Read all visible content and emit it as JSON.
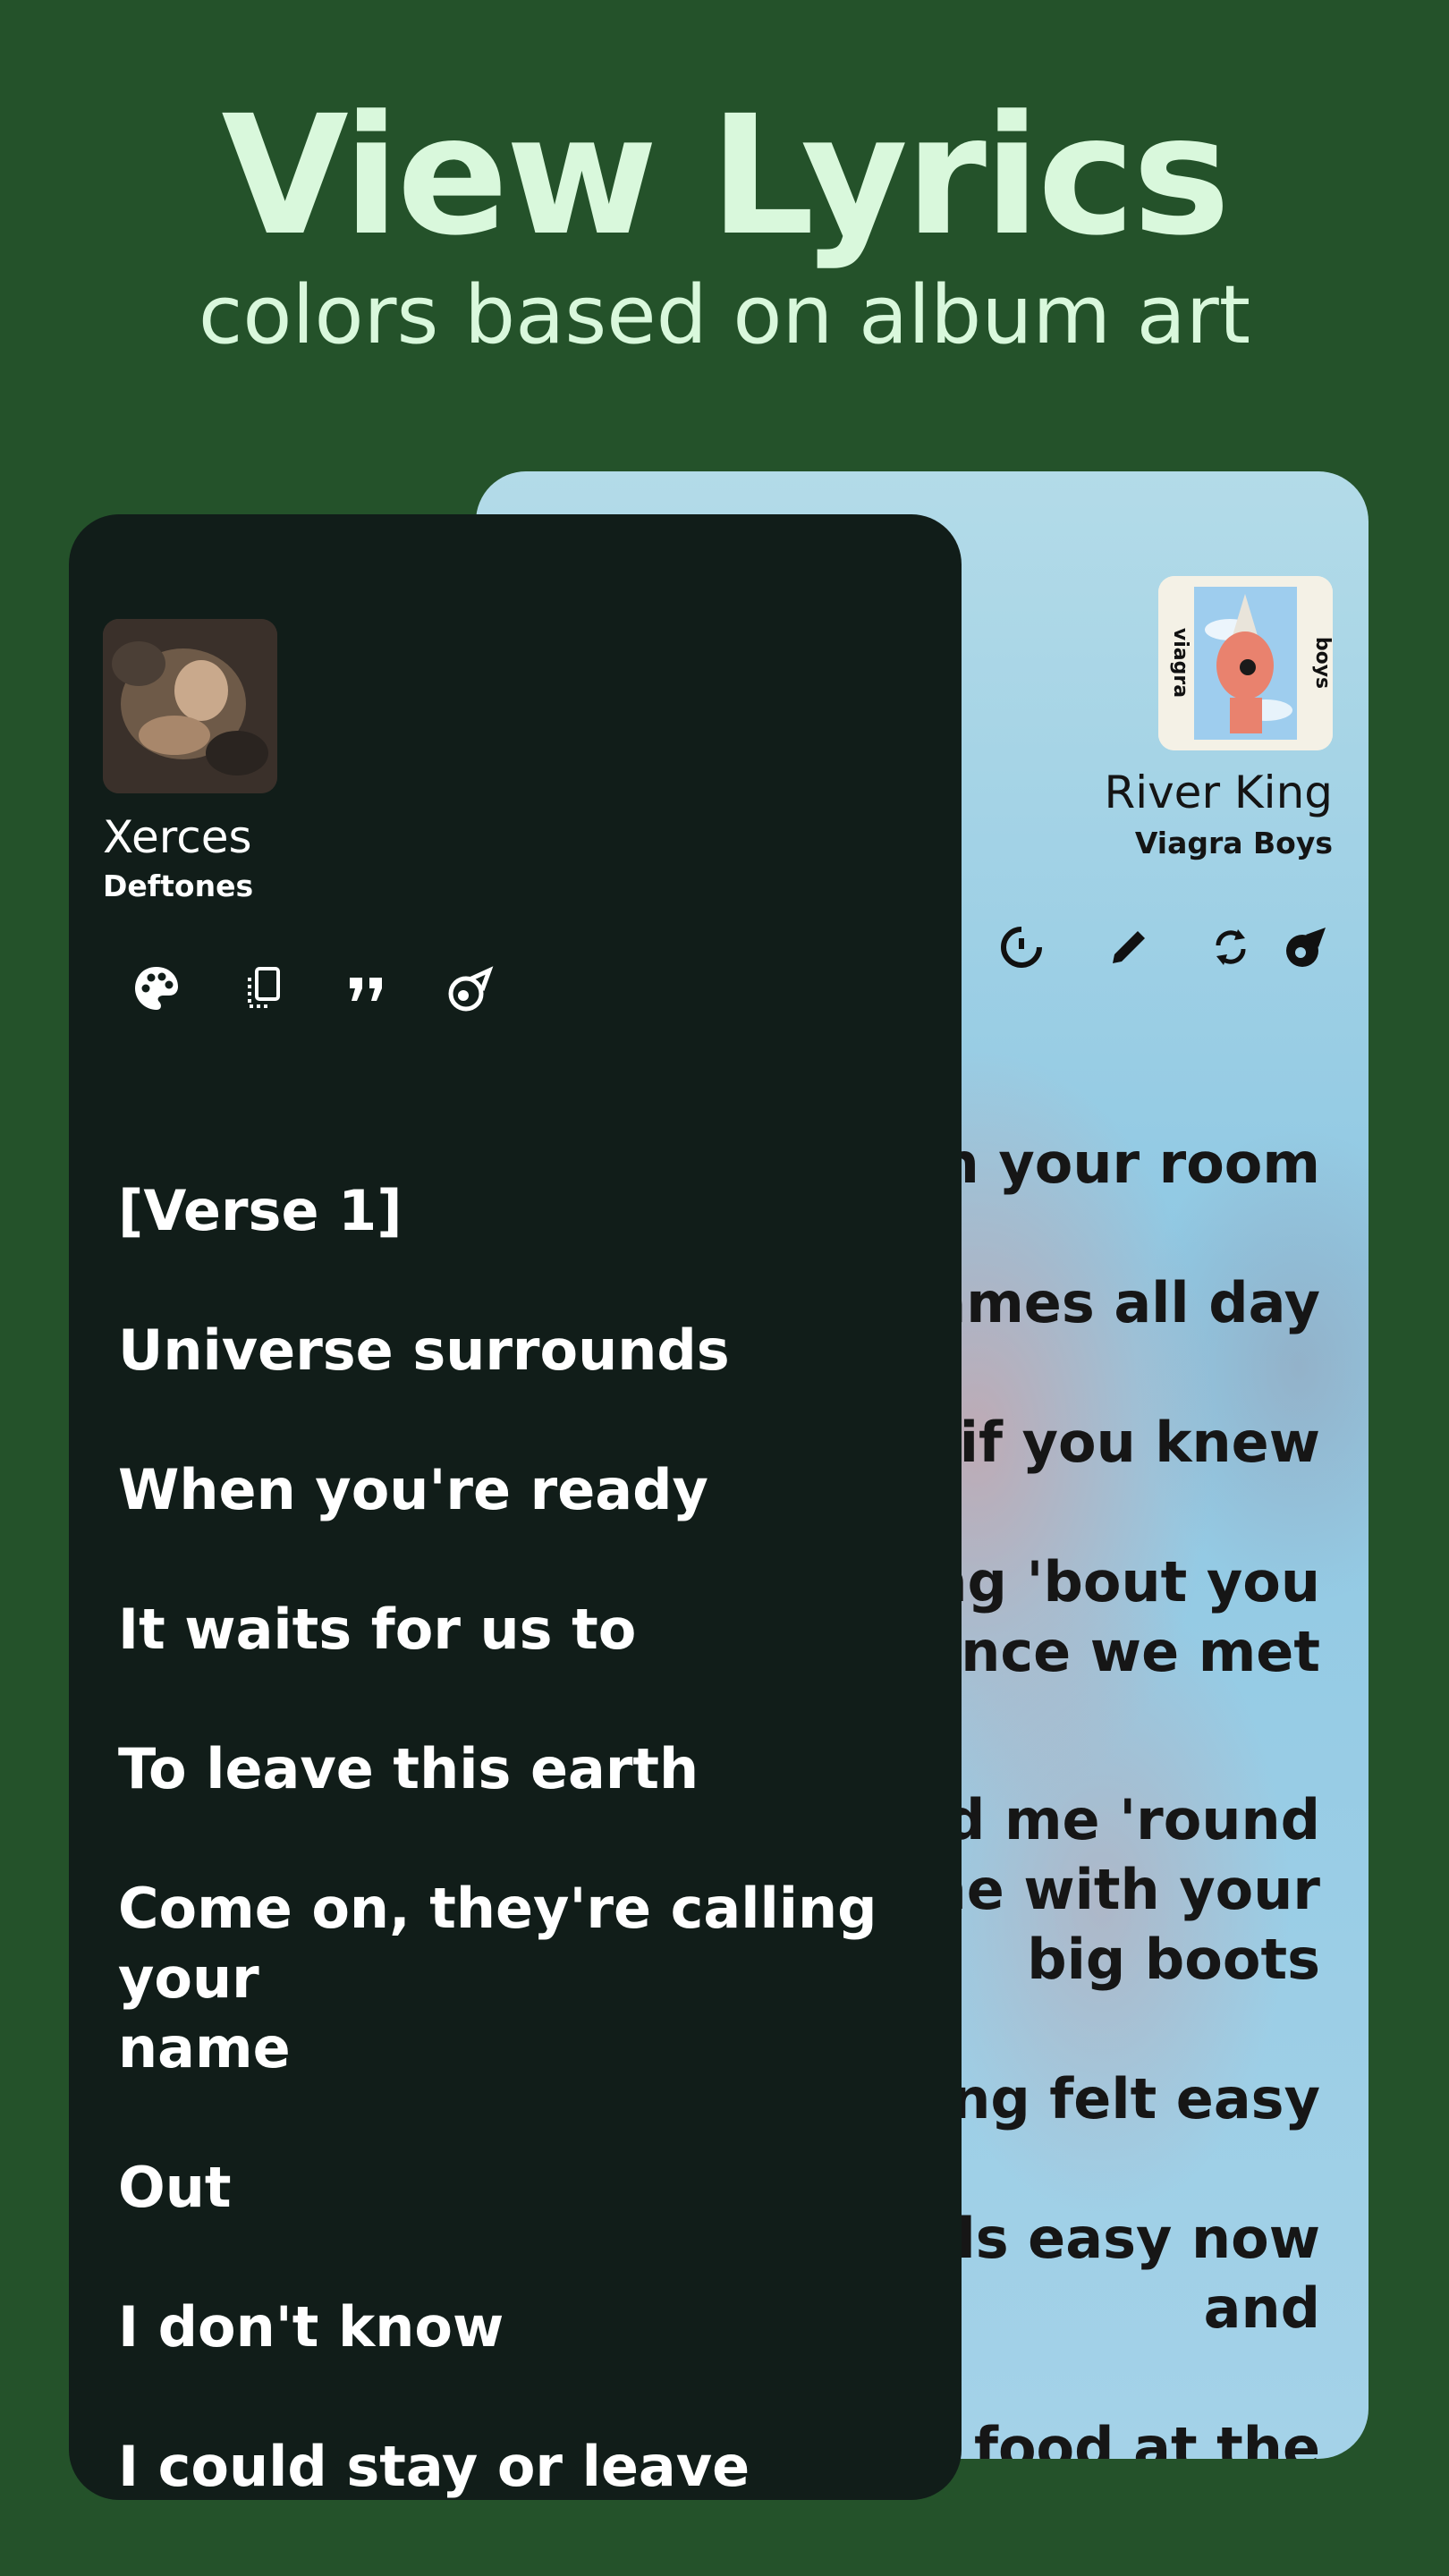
{
  "header": {
    "title": "View Lyrics",
    "subtitle": "colors based on album art"
  },
  "back_card": {
    "song_title": "River King",
    "artist": "Viagra Boys",
    "icons": [
      "timer-icon",
      "edit-icon",
      "sync-icon",
      "meteor-icon"
    ],
    "lyrics": [
      "in your room",
      "games all day",
      "er if you knew",
      "king 'bout you",
      "since we met",
      "sed me 'round",
      "me with your",
      "big boots",
      "hing felt easy",
      "eels easy now",
      "and",
      "e food at the"
    ]
  },
  "front_card": {
    "song_title": "Xerces",
    "artist": "Deftones",
    "icons": [
      "palette-icon",
      "copy-icon",
      "quote-icon",
      "meteor-icon"
    ],
    "lyrics": [
      "[Verse 1]",
      "Universe surrounds",
      "When you're ready",
      "It waits for us to",
      "To leave this earth",
      "Come on, they're calling your",
      "name",
      "Out",
      "I don't know",
      "I could stay or leave"
    ]
  },
  "colors": {
    "page_background": "#24522a",
    "headline": "#d9f8dc",
    "front_card": "#111d19",
    "back_card": "#9fd0e6"
  }
}
